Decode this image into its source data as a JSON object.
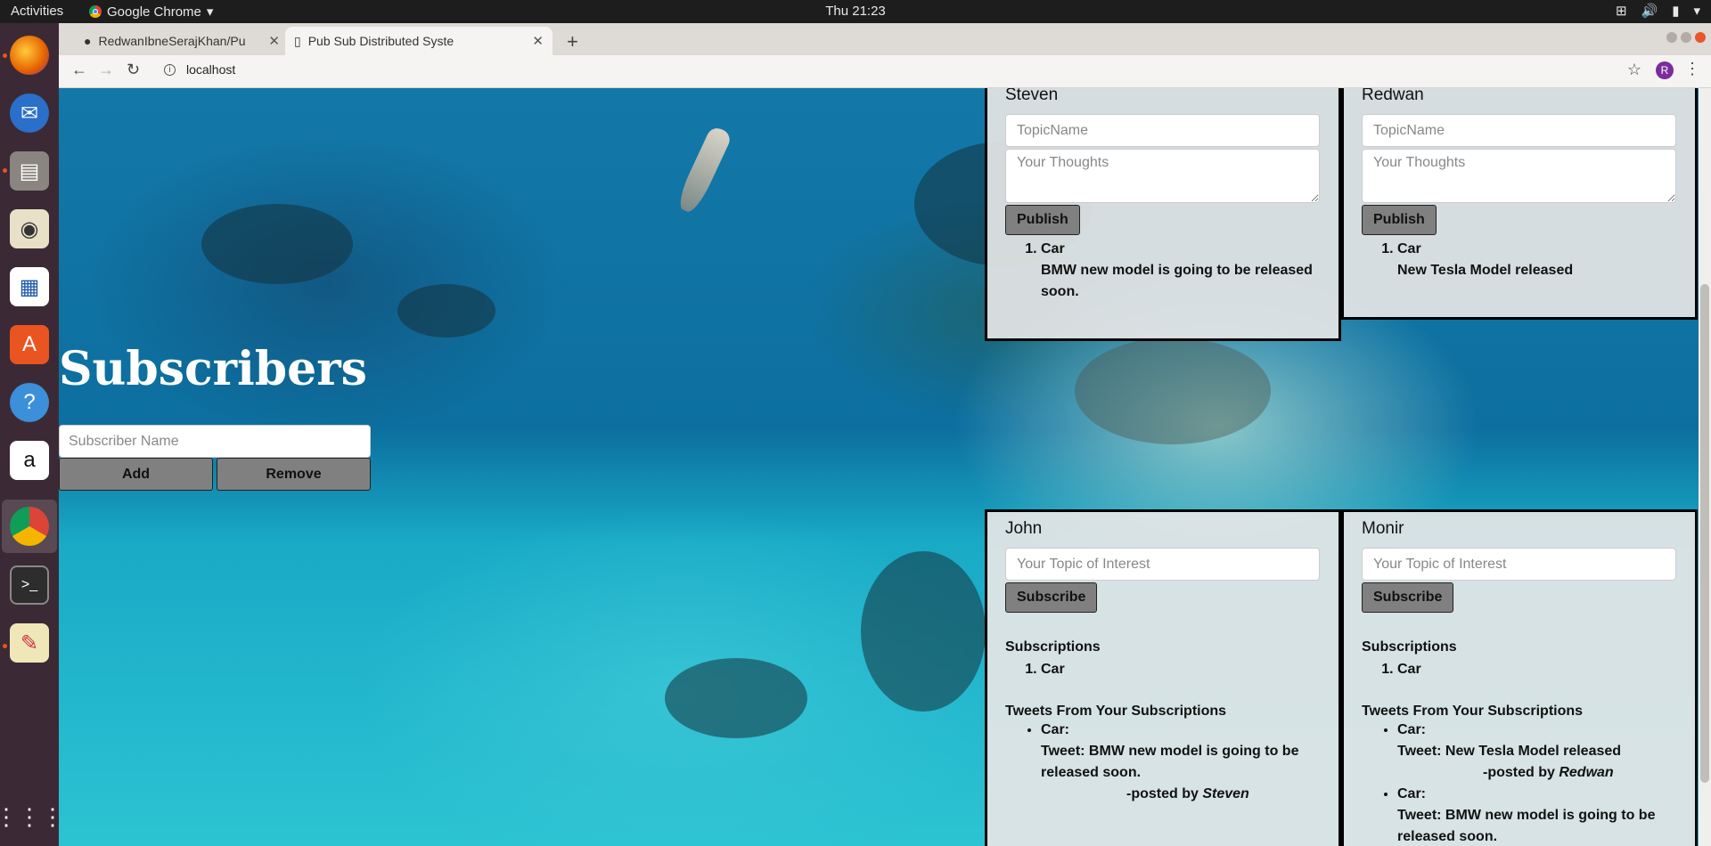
{
  "system": {
    "activities_label": "Activities",
    "app_name": "Google Chrome",
    "clock": "Thu 21:23"
  },
  "dock": {
    "apps": [
      "firefox-icon",
      "thunderbird-icon",
      "files-icon",
      "rhythmbox-icon",
      "writer-icon",
      "software-center-icon",
      "help-icon",
      "amazon-icon",
      "chrome-icon",
      "terminal-icon",
      "text-editor-icon",
      "show-apps-icon"
    ]
  },
  "browser": {
    "tabs": [
      {
        "title": "RedwanIbneSerajKhan/Pu",
        "active": false
      },
      {
        "title": "Pub Sub Distributed Syste",
        "active": true
      }
    ],
    "url": "localhost",
    "avatar_letter": "R"
  },
  "subscribers": {
    "title": "Subscribers",
    "name_placeholder": "Subscriber Name",
    "add_label": "Add",
    "remove_label": "Remove"
  },
  "publishers": [
    {
      "name": "Steven",
      "topic_placeholder": "TopicName",
      "thoughts_placeholder": "Your Thoughts",
      "publish_label": "Publish",
      "posts": [
        {
          "topic": "Car",
          "text": "BMW new model is going to be released soon."
        }
      ]
    },
    {
      "name": "Redwan",
      "topic_placeholder": "TopicName",
      "thoughts_placeholder": "Your Thoughts",
      "publish_label": "Publish",
      "posts": [
        {
          "topic": "Car",
          "text": "New Tesla Model released"
        }
      ]
    }
  ],
  "subscriber_cards": [
    {
      "name": "John",
      "topic_placeholder": "Your Topic of Interest",
      "subscribe_label": "Subscribe",
      "subscriptions_label": "Subscriptions",
      "subscriptions": [
        "Car"
      ],
      "tweets_label": "Tweets From Your Subscriptions",
      "tweets": [
        {
          "topic": "Car:",
          "tweet": "Tweet: BMW new model is going to be released soon.",
          "posted_by_prefix": "-posted by ",
          "author": "Steven"
        }
      ]
    },
    {
      "name": "Monir",
      "topic_placeholder": "Your Topic of Interest",
      "subscribe_label": "Subscribe",
      "subscriptions_label": "Subscriptions",
      "subscriptions": [
        "Car"
      ],
      "tweets_label": "Tweets From Your Subscriptions",
      "tweets": [
        {
          "topic": "Car:",
          "tweet": "Tweet: New Tesla Model released",
          "posted_by_prefix": "-posted by ",
          "author": "Redwan"
        },
        {
          "topic": "Car:",
          "tweet": "Tweet: BMW new model is going to be released soon.",
          "posted_by_prefix": "",
          "author": ""
        }
      ]
    }
  ]
}
